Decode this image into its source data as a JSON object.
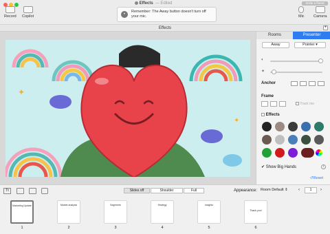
{
  "window": {
    "title": "Effects",
    "subtitle": "— Edited"
  },
  "toolbar": {
    "record": "Record",
    "copilot": "Copilot",
    "mic": "Mic",
    "camera": "Camera",
    "invite": "Invite a friend"
  },
  "notification": {
    "text": "Remember: The Away button doesn't turn off your mic."
  },
  "section_title": "Effects",
  "panel": {
    "tab_rooms": "Rooms",
    "tab_presenter": "Presenter",
    "away": "Away",
    "pointer": "Pointer",
    "anchor": "Anchor",
    "frame": "Frame",
    "track_me": "Track me",
    "effects": "Effects",
    "show_big_hands": "Show Big Hands",
    "reset": "Reset"
  },
  "bottom": {
    "slides_off": "Slides off",
    "shoulder": "Shoulder",
    "full": "Full",
    "appearance_label": "Appearance:",
    "appearance_value": "Room Default",
    "page": "1"
  },
  "slides": [
    {
      "num": "1",
      "title": "Marketing Update"
    },
    {
      "num": "2",
      "title": "Market analysis"
    },
    {
      "num": "3",
      "title": "Segments"
    },
    {
      "num": "4",
      "title": "Strategy"
    },
    {
      "num": "5",
      "title": "Insights"
    },
    {
      "num": "6",
      "title": "Thank you!"
    }
  ],
  "colors": {
    "accent": "#2f7bf0",
    "heart": "#e8424a"
  }
}
